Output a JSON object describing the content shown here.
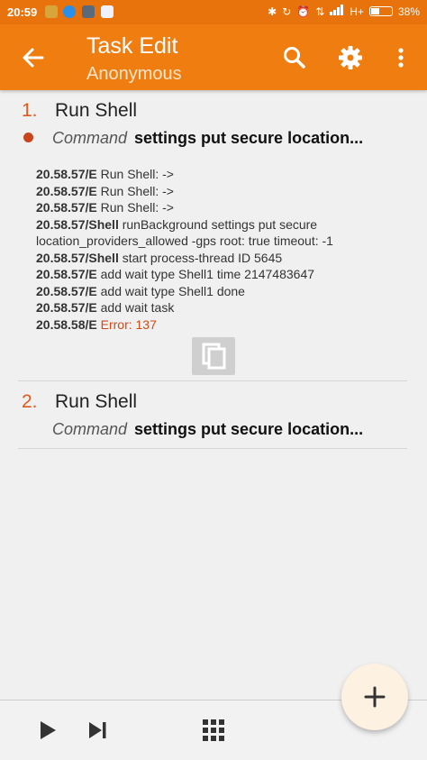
{
  "status_bar": {
    "time": "20:59",
    "network": "H+",
    "battery_percent_label": "38%",
    "battery_level": 0.38
  },
  "app_bar": {
    "title": "Task Edit",
    "subtitle": "Anonymous",
    "icons": [
      "back-arrow-icon",
      "search-icon",
      "gear-icon",
      "overflow-menu-icon"
    ]
  },
  "actions": [
    {
      "number": "1.",
      "name": "Run Shell",
      "param_key": "Command",
      "param_value": "settings put secure location...",
      "log": [
        {
          "ts": "20.58.57/E",
          "text": " Run Shell:  ->"
        },
        {
          "ts": "20.58.57/E",
          "text": " Run Shell:  ->"
        },
        {
          "ts": "20.58.57/E",
          "text": " Run Shell:  ->"
        },
        {
          "ts": "20.58.57/Shell",
          "text": " runBackground settings put secure"
        },
        {
          "ts": "",
          "text": "location_providers_allowed -gps root: true timeout: -1"
        },
        {
          "ts": "20.58.57/Shell",
          "text": " start process-thread ID 5645"
        },
        {
          "ts": "20.58.57/E",
          "text": " add wait type Shell1 time 2147483647"
        },
        {
          "ts": "20.58.57/E",
          "text": " add wait type Shell1 done"
        },
        {
          "ts": "20.58.57/E",
          "text": " add wait task"
        },
        {
          "ts": "20.58.58/E",
          "text": " Error: 137",
          "error": true
        }
      ]
    },
    {
      "number": "2.",
      "name": "Run Shell",
      "param_key": "Command",
      "param_value": "settings put secure location..."
    }
  ],
  "bottom_bar": {
    "icons": [
      "play-icon",
      "skip-next-icon",
      "grid-icon"
    ]
  },
  "fab": {
    "icon": "plus-icon"
  },
  "colors": {
    "app_bar": "#f07d0f",
    "status_bar": "#e8720c",
    "accent_number": "#e0581c",
    "error": "#d14a13"
  }
}
